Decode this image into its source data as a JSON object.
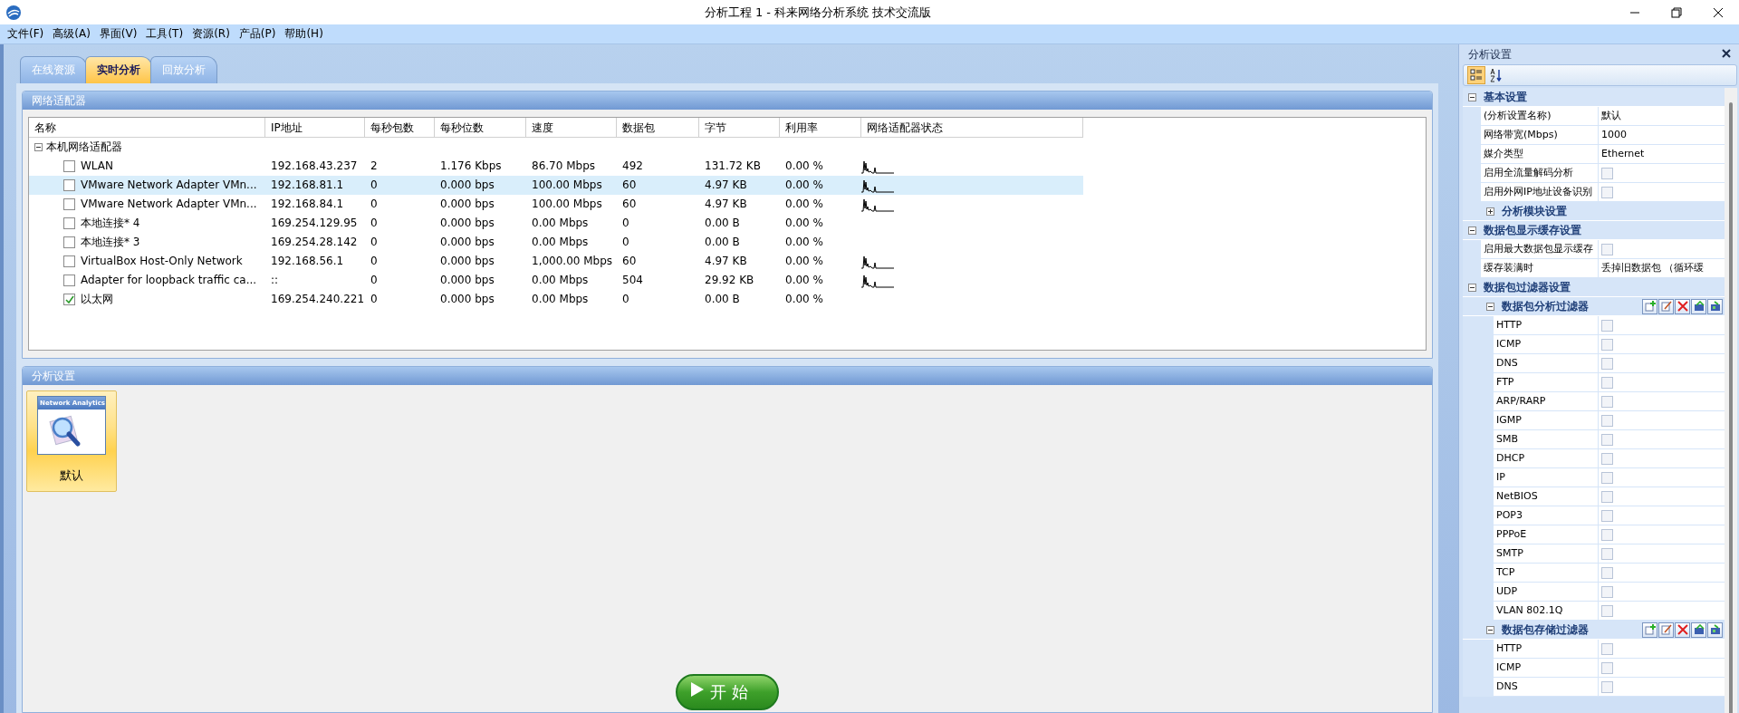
{
  "window": {
    "title": "分析工程 1 - 科来网络分析系统 技术交流版"
  },
  "menu": [
    "文件(F)",
    "高级(A)",
    "界面(V)",
    "工具(T)",
    "资源(R)",
    "产品(P)",
    "帮助(H)"
  ],
  "tabs": [
    {
      "label": "在线资源",
      "selected": false
    },
    {
      "label": "实时分析",
      "selected": true
    },
    {
      "label": "回放分析",
      "selected": false
    }
  ],
  "adapters_panel": {
    "title": "网络适配器",
    "columns": [
      "名称",
      "IP地址",
      "每秒包数",
      "每秒位数",
      "速度",
      "数据包",
      "字节",
      "利用率",
      "网络适配器状态"
    ],
    "root": {
      "label": "本机网络适配器",
      "expanded": true,
      "children": [
        {
          "name": "WLAN",
          "checked": false,
          "selected": false,
          "ip": "192.168.43.237",
          "pps": "2",
          "bps": "1.176 Kbps",
          "speed": "86.70 Mbps",
          "packets": "492",
          "bytes": "131.72 KB",
          "utilization": "0.00 %",
          "activity_graph": true
        },
        {
          "name": "VMware Network Adapter VMn...",
          "checked": false,
          "selected": true,
          "ip": "192.168.81.1",
          "pps": "0",
          "bps": "0.000 bps",
          "speed": "100.00 Mbps",
          "packets": "60",
          "bytes": "4.97 KB",
          "utilization": "0.00 %",
          "activity_graph": true
        },
        {
          "name": "VMware Network Adapter VMn...",
          "checked": false,
          "selected": false,
          "ip": "192.168.84.1",
          "pps": "0",
          "bps": "0.000 bps",
          "speed": "100.00 Mbps",
          "packets": "60",
          "bytes": "4.97 KB",
          "utilization": "0.00 %",
          "activity_graph": true
        },
        {
          "name": "本地连接* 4",
          "checked": false,
          "selected": false,
          "ip": "169.254.129.95",
          "pps": "0",
          "bps": "0.000 bps",
          "speed": "0.00 Mbps",
          "packets": "0",
          "bytes": "0.00 B",
          "utilization": "0.00 %",
          "activity_graph": false
        },
        {
          "name": "本地连接* 3",
          "checked": false,
          "selected": false,
          "ip": "169.254.28.142",
          "pps": "0",
          "bps": "0.000 bps",
          "speed": "0.00 Mbps",
          "packets": "0",
          "bytes": "0.00 B",
          "utilization": "0.00 %",
          "activity_graph": false
        },
        {
          "name": "VirtualBox Host-Only Network",
          "checked": false,
          "selected": false,
          "ip": "192.168.56.1",
          "pps": "0",
          "bps": "0.000 bps",
          "speed": "1,000.00 Mbps",
          "packets": "60",
          "bytes": "4.97 KB",
          "utilization": "0.00 %",
          "activity_graph": true
        },
        {
          "name": "Adapter for loopback traffic ca...",
          "checked": false,
          "selected": false,
          "ip": "::",
          "pps": "0",
          "bps": "0.000 bps",
          "speed": "0.00 Mbps",
          "packets": "504",
          "bytes": "29.92 KB",
          "utilization": "0.00 %",
          "activity_graph": true
        },
        {
          "name": "以太网",
          "checked": true,
          "selected": false,
          "ip": "169.254.240.221",
          "pps": "0",
          "bps": "0.000 bps",
          "speed": "0.00 Mbps",
          "packets": "0",
          "bytes": "0.00 B",
          "utilization": "0.00 %",
          "activity_graph": false
        }
      ]
    }
  },
  "profiles_panel": {
    "title": "分析设置",
    "profiles": [
      {
        "label": "默认",
        "icon_caption": "Network Analytics",
        "selected": true
      }
    ],
    "start_button": "开 始"
  },
  "settings_pane": {
    "title": "分析设置",
    "view_buttons": [
      {
        "kind": "categorized",
        "selected": true
      },
      {
        "kind": "alphabetical",
        "selected": false
      }
    ],
    "categories": [
      {
        "label": "基本设置",
        "expanded": true,
        "children": [
          {
            "kind": "text",
            "name": "(分析设置名称)",
            "value": "默认"
          },
          {
            "kind": "text",
            "name": "网络带宽(Mbps)",
            "value": "1000"
          },
          {
            "kind": "text",
            "name": "媒介类型",
            "value": "Ethernet"
          },
          {
            "kind": "check",
            "name": "启用全流量解码分析",
            "checked": false
          },
          {
            "kind": "check",
            "name": "启用外网IP地址设备识别",
            "checked": false
          },
          {
            "kind": "group",
            "label": "分析模块设置",
            "expanded": false,
            "toolbar": false
          }
        ]
      },
      {
        "label": "数据包显示缓存设置",
        "expanded": true,
        "children": [
          {
            "kind": "check",
            "name": "启用最大数据包显示缓存",
            "checked": false
          },
          {
            "kind": "text",
            "name": "缓存装满时",
            "value": "丢掉旧数据包 （循环缓"
          }
        ]
      },
      {
        "label": "数据包过滤器设置",
        "expanded": true,
        "children": [
          {
            "kind": "group",
            "label": "数据包分析过滤器",
            "expanded": true,
            "toolbar": true,
            "children": [
              {
                "kind": "check",
                "name": "HTTP",
                "checked": false
              },
              {
                "kind": "check",
                "name": "ICMP",
                "checked": false
              },
              {
                "kind": "check",
                "name": "DNS",
                "checked": false
              },
              {
                "kind": "check",
                "name": "FTP",
                "checked": false
              },
              {
                "kind": "check",
                "name": "ARP/RARP",
                "checked": false
              },
              {
                "kind": "check",
                "name": "IGMP",
                "checked": false
              },
              {
                "kind": "check",
                "name": "SMB",
                "checked": false
              },
              {
                "kind": "check",
                "name": "DHCP",
                "checked": false
              },
              {
                "kind": "check",
                "name": "IP",
                "checked": false
              },
              {
                "kind": "check",
                "name": "NetBIOS",
                "checked": false
              },
              {
                "kind": "check",
                "name": "POP3",
                "checked": false
              },
              {
                "kind": "check",
                "name": "PPPoE",
                "checked": false
              },
              {
                "kind": "check",
                "name": "SMTP",
                "checked": false
              },
              {
                "kind": "check",
                "name": "TCP",
                "checked": false
              },
              {
                "kind": "check",
                "name": "UDP",
                "checked": false
              },
              {
                "kind": "check",
                "name": "VLAN 802.1Q",
                "checked": false
              }
            ]
          },
          {
            "kind": "group",
            "label": "数据包存储过滤器",
            "expanded": true,
            "toolbar": true,
            "children": [
              {
                "kind": "check",
                "name": "HTTP",
                "checked": false
              },
              {
                "kind": "check",
                "name": "ICMP",
                "checked": false
              },
              {
                "kind": "check",
                "name": "DNS",
                "checked": false
              }
            ]
          }
        ]
      }
    ]
  }
}
